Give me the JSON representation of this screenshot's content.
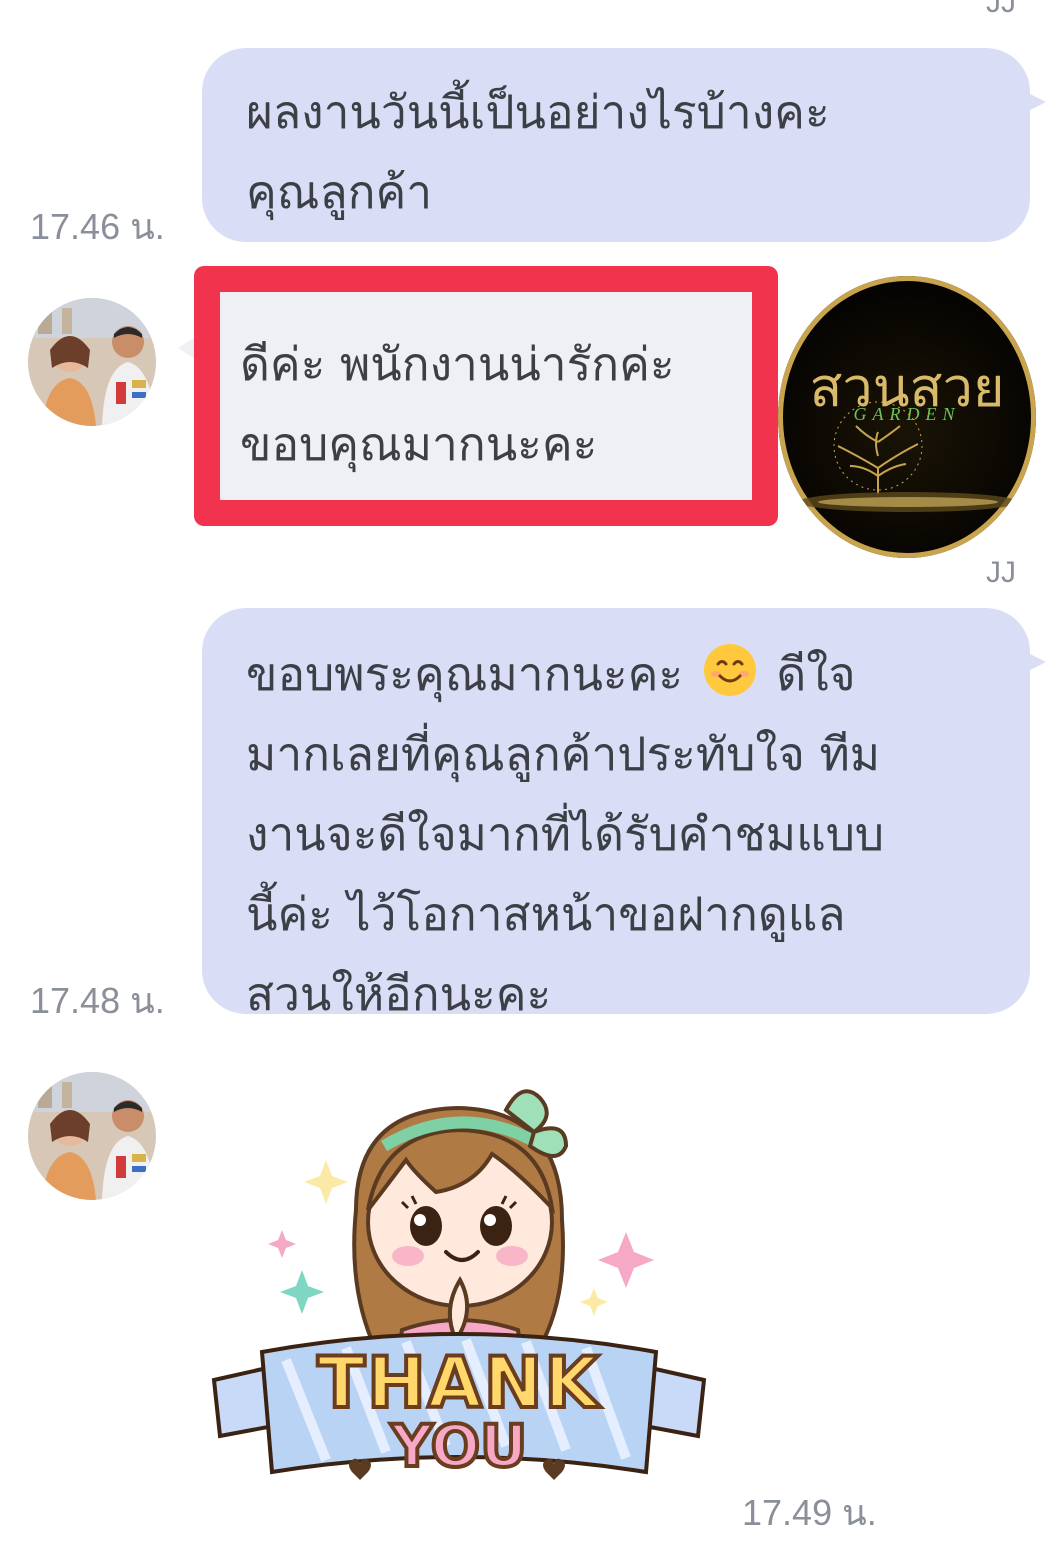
{
  "messages": {
    "top_sender_name": "JJ",
    "outgoing_1": {
      "lines": [
        "ผลงานวันนี้เป็นอย่างไรบ้างคะ",
        "คุณลูกค้า"
      ],
      "time": "17.46 น."
    },
    "incoming_1": {
      "lines": [
        "ดีค่ะ พนักงานน่ารักค่ะ",
        "ขอบคุณมากนะคะ"
      ]
    },
    "brand_logo": {
      "title": "สวนสวย",
      "subtitle": "GARDEN"
    },
    "sender_name": "JJ",
    "outgoing_2": {
      "line1_a": "ขอบพระคุณมากนะคะ",
      "line1_b": "ดีใจ",
      "lines": [
        "มากเลยที่คุณลูกค้าประทับใจ ทีม",
        "งานจะดีใจมากที่ได้รับคำชมแบบ",
        "นี้ค่ะ ไว้โอกาสหน้าขอฝากดูแล",
        "สวนให้อีกนะคะ"
      ],
      "emoji": "smiling-face-emoji",
      "time": "17.48 น."
    },
    "sticker": {
      "line1": "THANK",
      "line2": "YOU",
      "time": "17.49 น."
    }
  },
  "colors": {
    "outgoing_bubble": "#d9def6",
    "incoming_bubble": "#eef0f4",
    "highlight": "#f2334d",
    "timestamp": "#8a8f99"
  }
}
